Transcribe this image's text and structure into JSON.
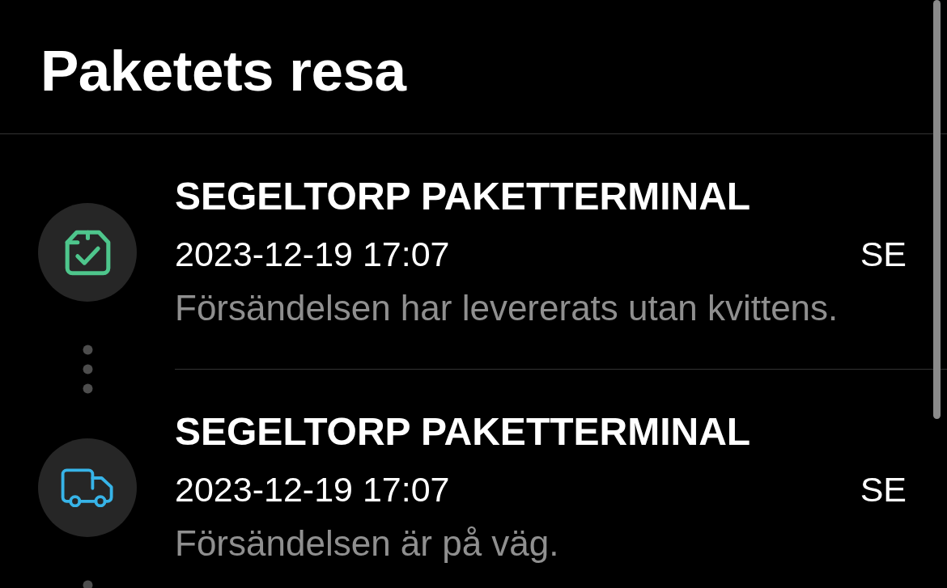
{
  "header": {
    "title": "Paketets resa"
  },
  "events": [
    {
      "kind": "delivered",
      "color": "#4ec68c",
      "location": "SEGELTORP PAKETTERMINAL",
      "datetime": "2023-12-19 17:07",
      "country": "SE",
      "description": "Försändelsen har levererats utan kvittens."
    },
    {
      "kind": "in_transit",
      "color": "#37b4e8",
      "location": "SEGELTORP PAKETTERMINAL",
      "datetime": "2023-12-19 17:07",
      "country": "SE",
      "description": "Försändelsen är på väg."
    }
  ]
}
